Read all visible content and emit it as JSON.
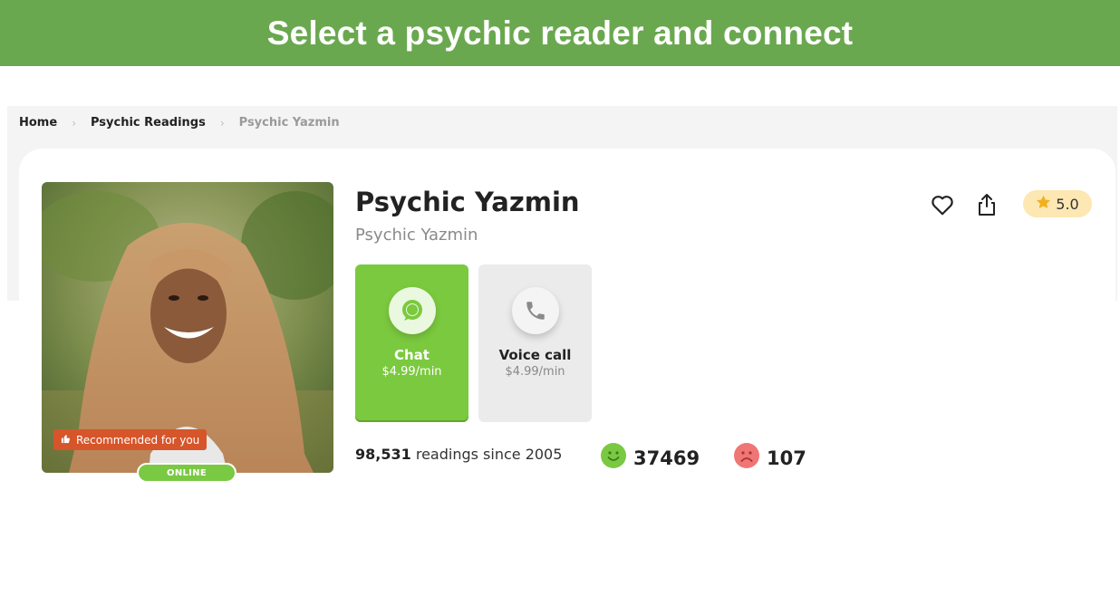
{
  "banner": {
    "title": "Select a psychic reader and connect"
  },
  "breadcrumb": {
    "items": [
      "Home",
      "Psychic Readings",
      "Psychic Yazmin"
    ],
    "separator": "›"
  },
  "profile": {
    "name": "Psychic Yazmin",
    "subtitle": "Psychic Yazmin",
    "recommended_label": "Recommended for you",
    "status": "ONLINE",
    "rating": "5.0",
    "readings_count": "98,531",
    "readings_suffix": "readings since 2005",
    "positive_feedback": "37469",
    "negative_feedback": "107"
  },
  "services": {
    "chat": {
      "label": "Chat",
      "price": "$4.99/min"
    },
    "voice": {
      "label": "Voice call",
      "price": "$4.99/min"
    }
  },
  "icons": {
    "favorite": "heart-icon",
    "share": "share-icon",
    "rating": "star-icon",
    "chat": "chat-bubble-icon",
    "voice": "phone-icon",
    "recommended": "thumbs-up-icon",
    "positive": "smile-icon",
    "negative": "frown-icon"
  },
  "colors": {
    "banner": "#6aa84f",
    "chat_button": "#7bc93f",
    "online_badge": "#7ac943",
    "recommended_badge": "#d6552a",
    "rating_badge": "#fde7b3",
    "positive": "#7ac943",
    "negative": "#f07575"
  }
}
